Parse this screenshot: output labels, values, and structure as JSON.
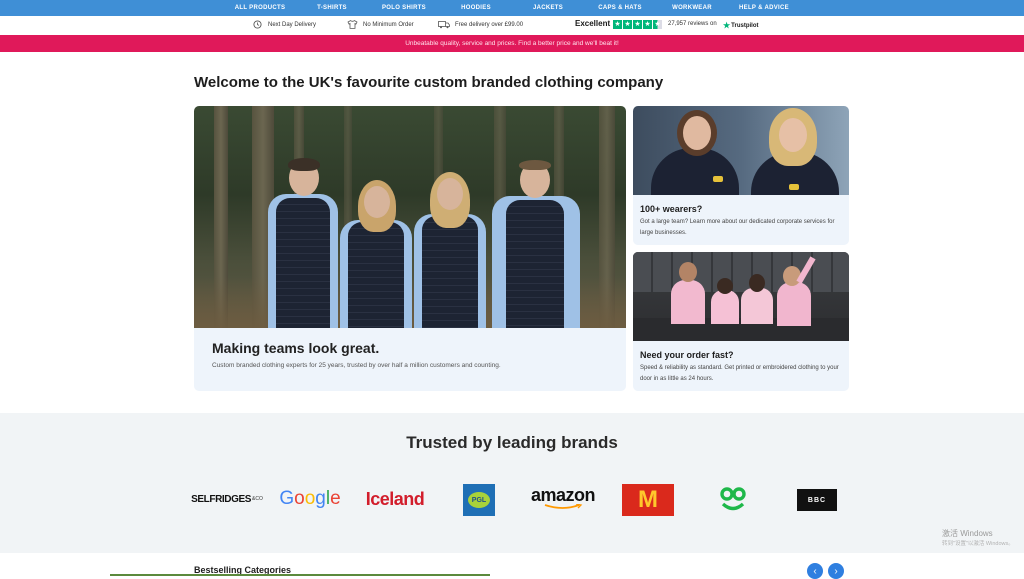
{
  "nav": {
    "items": [
      "ALL PRODUCTS",
      "T-SHIRTS",
      "POLO SHIRTS",
      "HOODIES",
      "JACKETS",
      "CAPS & HATS",
      "WORKWEAR",
      "HELP & ADVICE"
    ]
  },
  "usp": {
    "items": [
      "Next Day Delivery",
      "No Minimum Order",
      "Free delivery over £99.00"
    ],
    "trustpilot": {
      "rating_word": "Excellent",
      "stars": 4.5,
      "reviews": "27,957 reviews on",
      "brand": "Trustpilot"
    }
  },
  "promo": {
    "text": "Unbeatable quality, service and prices. Find a better price and we'll beat it!"
  },
  "main": {
    "welcome": "Welcome to the UK's favourite custom branded clothing company",
    "hero": {
      "title": "Making teams look great.",
      "subtitle": "Custom branded clothing experts for 25 years, trusted by over half a million customers and counting."
    },
    "cards": [
      {
        "title": "100+ wearers?",
        "desc": "Got a large team? Learn more about our dedicated corporate services for large businesses."
      },
      {
        "title": "Need your order fast?",
        "desc": "Speed & reliability as standard. Get printed or embroidered clothing to your door in as little as 24 hours."
      }
    ]
  },
  "brands": {
    "title": "Trusted by leading brands",
    "logos": [
      {
        "name": "selfridges-logo",
        "text": "SELFRIDGES",
        "extra": "&CO"
      },
      {
        "name": "google-logo",
        "text": "Google"
      },
      {
        "name": "iceland-logo",
        "text": "Iceland"
      },
      {
        "name": "pgl-logo",
        "text": "PGL"
      },
      {
        "name": "amazon-logo",
        "text": "amazon"
      },
      {
        "name": "mcdonalds-logo",
        "text": "M"
      },
      {
        "name": "ao-logo",
        "text": "ao"
      },
      {
        "name": "bbc-logo",
        "text": "BBC"
      }
    ]
  },
  "bestselling": {
    "title": "Bestselling Categories",
    "prev": "‹",
    "next": "›"
  },
  "watermark": {
    "line1": "激活 Windows",
    "line2": "转到\"设置\"以激活 Windows。"
  },
  "colors": {
    "nav_bg": "#3f8fd6",
    "promo_bg": "#e0195a",
    "trustpilot_green": "#00b67a",
    "card_bg": "#eef4fb"
  }
}
